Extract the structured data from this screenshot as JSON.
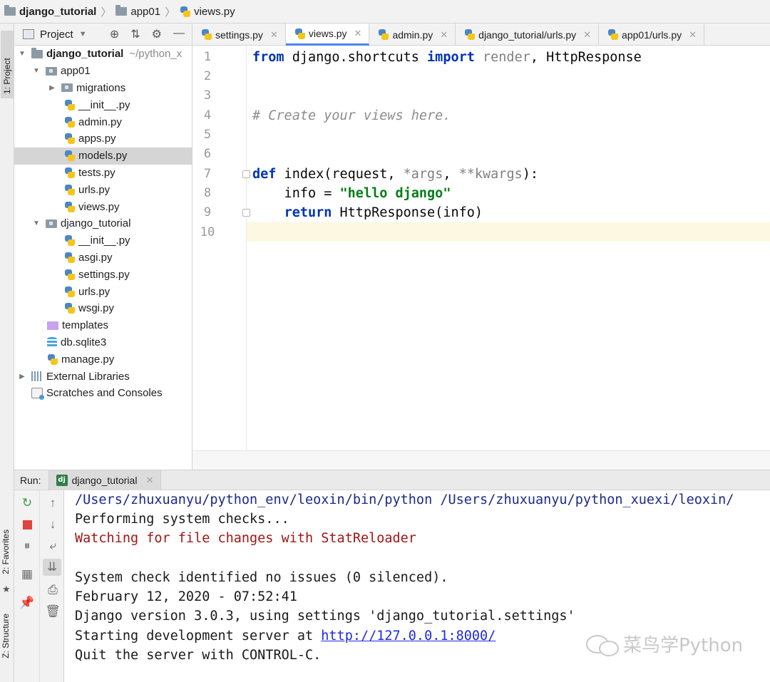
{
  "breadcrumb": {
    "items": [
      "django_tutorial",
      "app01",
      "views.py"
    ]
  },
  "side_strip": {
    "project": "1: Project",
    "favorites": "2: Favorites",
    "structure": "Z: Structure"
  },
  "project_panel": {
    "title": "Project",
    "tree": [
      {
        "label": "django_tutorial",
        "path": "~/python_x"
      },
      {
        "label": "app01"
      },
      {
        "label": "migrations"
      },
      {
        "label": "__init__.py"
      },
      {
        "label": "admin.py"
      },
      {
        "label": "apps.py"
      },
      {
        "label": "models.py"
      },
      {
        "label": "tests.py"
      },
      {
        "label": "urls.py"
      },
      {
        "label": "views.py"
      },
      {
        "label": "django_tutorial"
      },
      {
        "label": "__init__.py"
      },
      {
        "label": "asgi.py"
      },
      {
        "label": "settings.py"
      },
      {
        "label": "urls.py"
      },
      {
        "label": "wsgi.py"
      },
      {
        "label": "templates"
      },
      {
        "label": "db.sqlite3"
      },
      {
        "label": "manage.py"
      },
      {
        "label": "External Libraries"
      },
      {
        "label": "Scratches and Consoles"
      }
    ]
  },
  "editor_tabs": [
    "settings.py",
    "views.py",
    "admin.py",
    "django_tutorial/urls.py",
    "app01/urls.py"
  ],
  "editor": {
    "line_numbers": [
      "1",
      "2",
      "3",
      "4",
      "5",
      "6",
      "7",
      "8",
      "9",
      "10"
    ],
    "lines": {
      "l1": {
        "a": "from",
        "b": " django.shortcuts ",
        "c": "import",
        "d": " render",
        "e": ", HttpResponse"
      },
      "l4": "# Create your views here.",
      "l7": {
        "a": "def",
        "b": " index(request, ",
        "c": "*args",
        "d": ", ",
        "e": "**kwargs",
        "f": "):"
      },
      "l8": {
        "a": "    info = ",
        "b": "\"hello django\""
      },
      "l9": {
        "a": "    ",
        "b": "return",
        "c": " HttpResponse(info)"
      }
    }
  },
  "run": {
    "label": "Run:",
    "tab": "django_tutorial",
    "tab_icon": "dj",
    "console": {
      "line1": "/Users/zhuxuanyu/python_env/leoxin/bin/python /Users/zhuxuanyu/python_xuexi/leoxin/",
      "line2": "Performing system checks...",
      "line3": "Watching for file changes with StatReloader",
      "line5": "System check identified no issues (0 silenced).",
      "line6": "February 12, 2020 - 07:52:41",
      "line7": "Django version 3.0.3, using settings 'django_tutorial.settings'",
      "line8_prefix": "Starting development server at ",
      "line8_link": "http://127.0.0.1:8000/",
      "line9": "Quit the server with CONTROL-C."
    }
  },
  "watermark": "菜鸟学Python",
  "colors": {
    "keyword": "#0033b3",
    "string": "#067d17",
    "comment": "#8c8c8c",
    "console_red": "#a31515",
    "link": "#1f2bd8",
    "current_line": "#fdf8e1"
  }
}
